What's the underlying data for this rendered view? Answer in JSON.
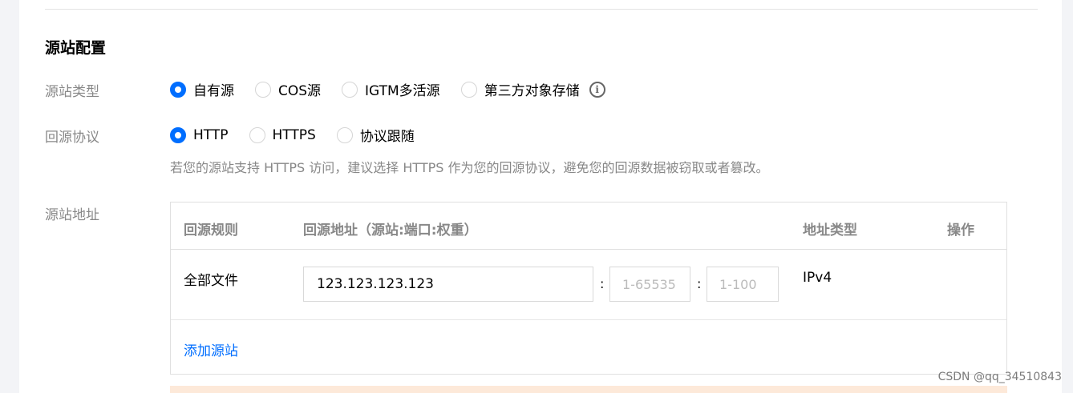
{
  "section_title": "源站配置",
  "origin_type": {
    "label": "源站类型",
    "options": [
      "自有源",
      "COS源",
      "IGTM多活源",
      "第三方对象存储"
    ],
    "selected": "自有源"
  },
  "origin_protocol": {
    "label": "回源协议",
    "options": [
      "HTTP",
      "HTTPS",
      "协议跟随"
    ],
    "selected": "HTTP",
    "hint": "若您的源站支持 HTTPS 访问，建议选择 HTTPS 作为您的回源协议，避免您的回源数据被窃取或者篡改。"
  },
  "origin_address": {
    "label": "源站地址",
    "columns": [
      "回源规则",
      "回源地址（源站:端口:权重）",
      "地址类型",
      "操作"
    ],
    "rows": [
      {
        "rule": "全部文件",
        "address_value": "123.123.123.123",
        "port_placeholder": "1-65535",
        "weight_placeholder": "1-100",
        "separator": ":",
        "address_type": "IPv4"
      }
    ],
    "add_link": "添加源站"
  },
  "watermark": "CSDN @qq_34510843",
  "colors": {
    "accent": "#006eff",
    "label": "#888888",
    "warn": "#fde9d9"
  }
}
